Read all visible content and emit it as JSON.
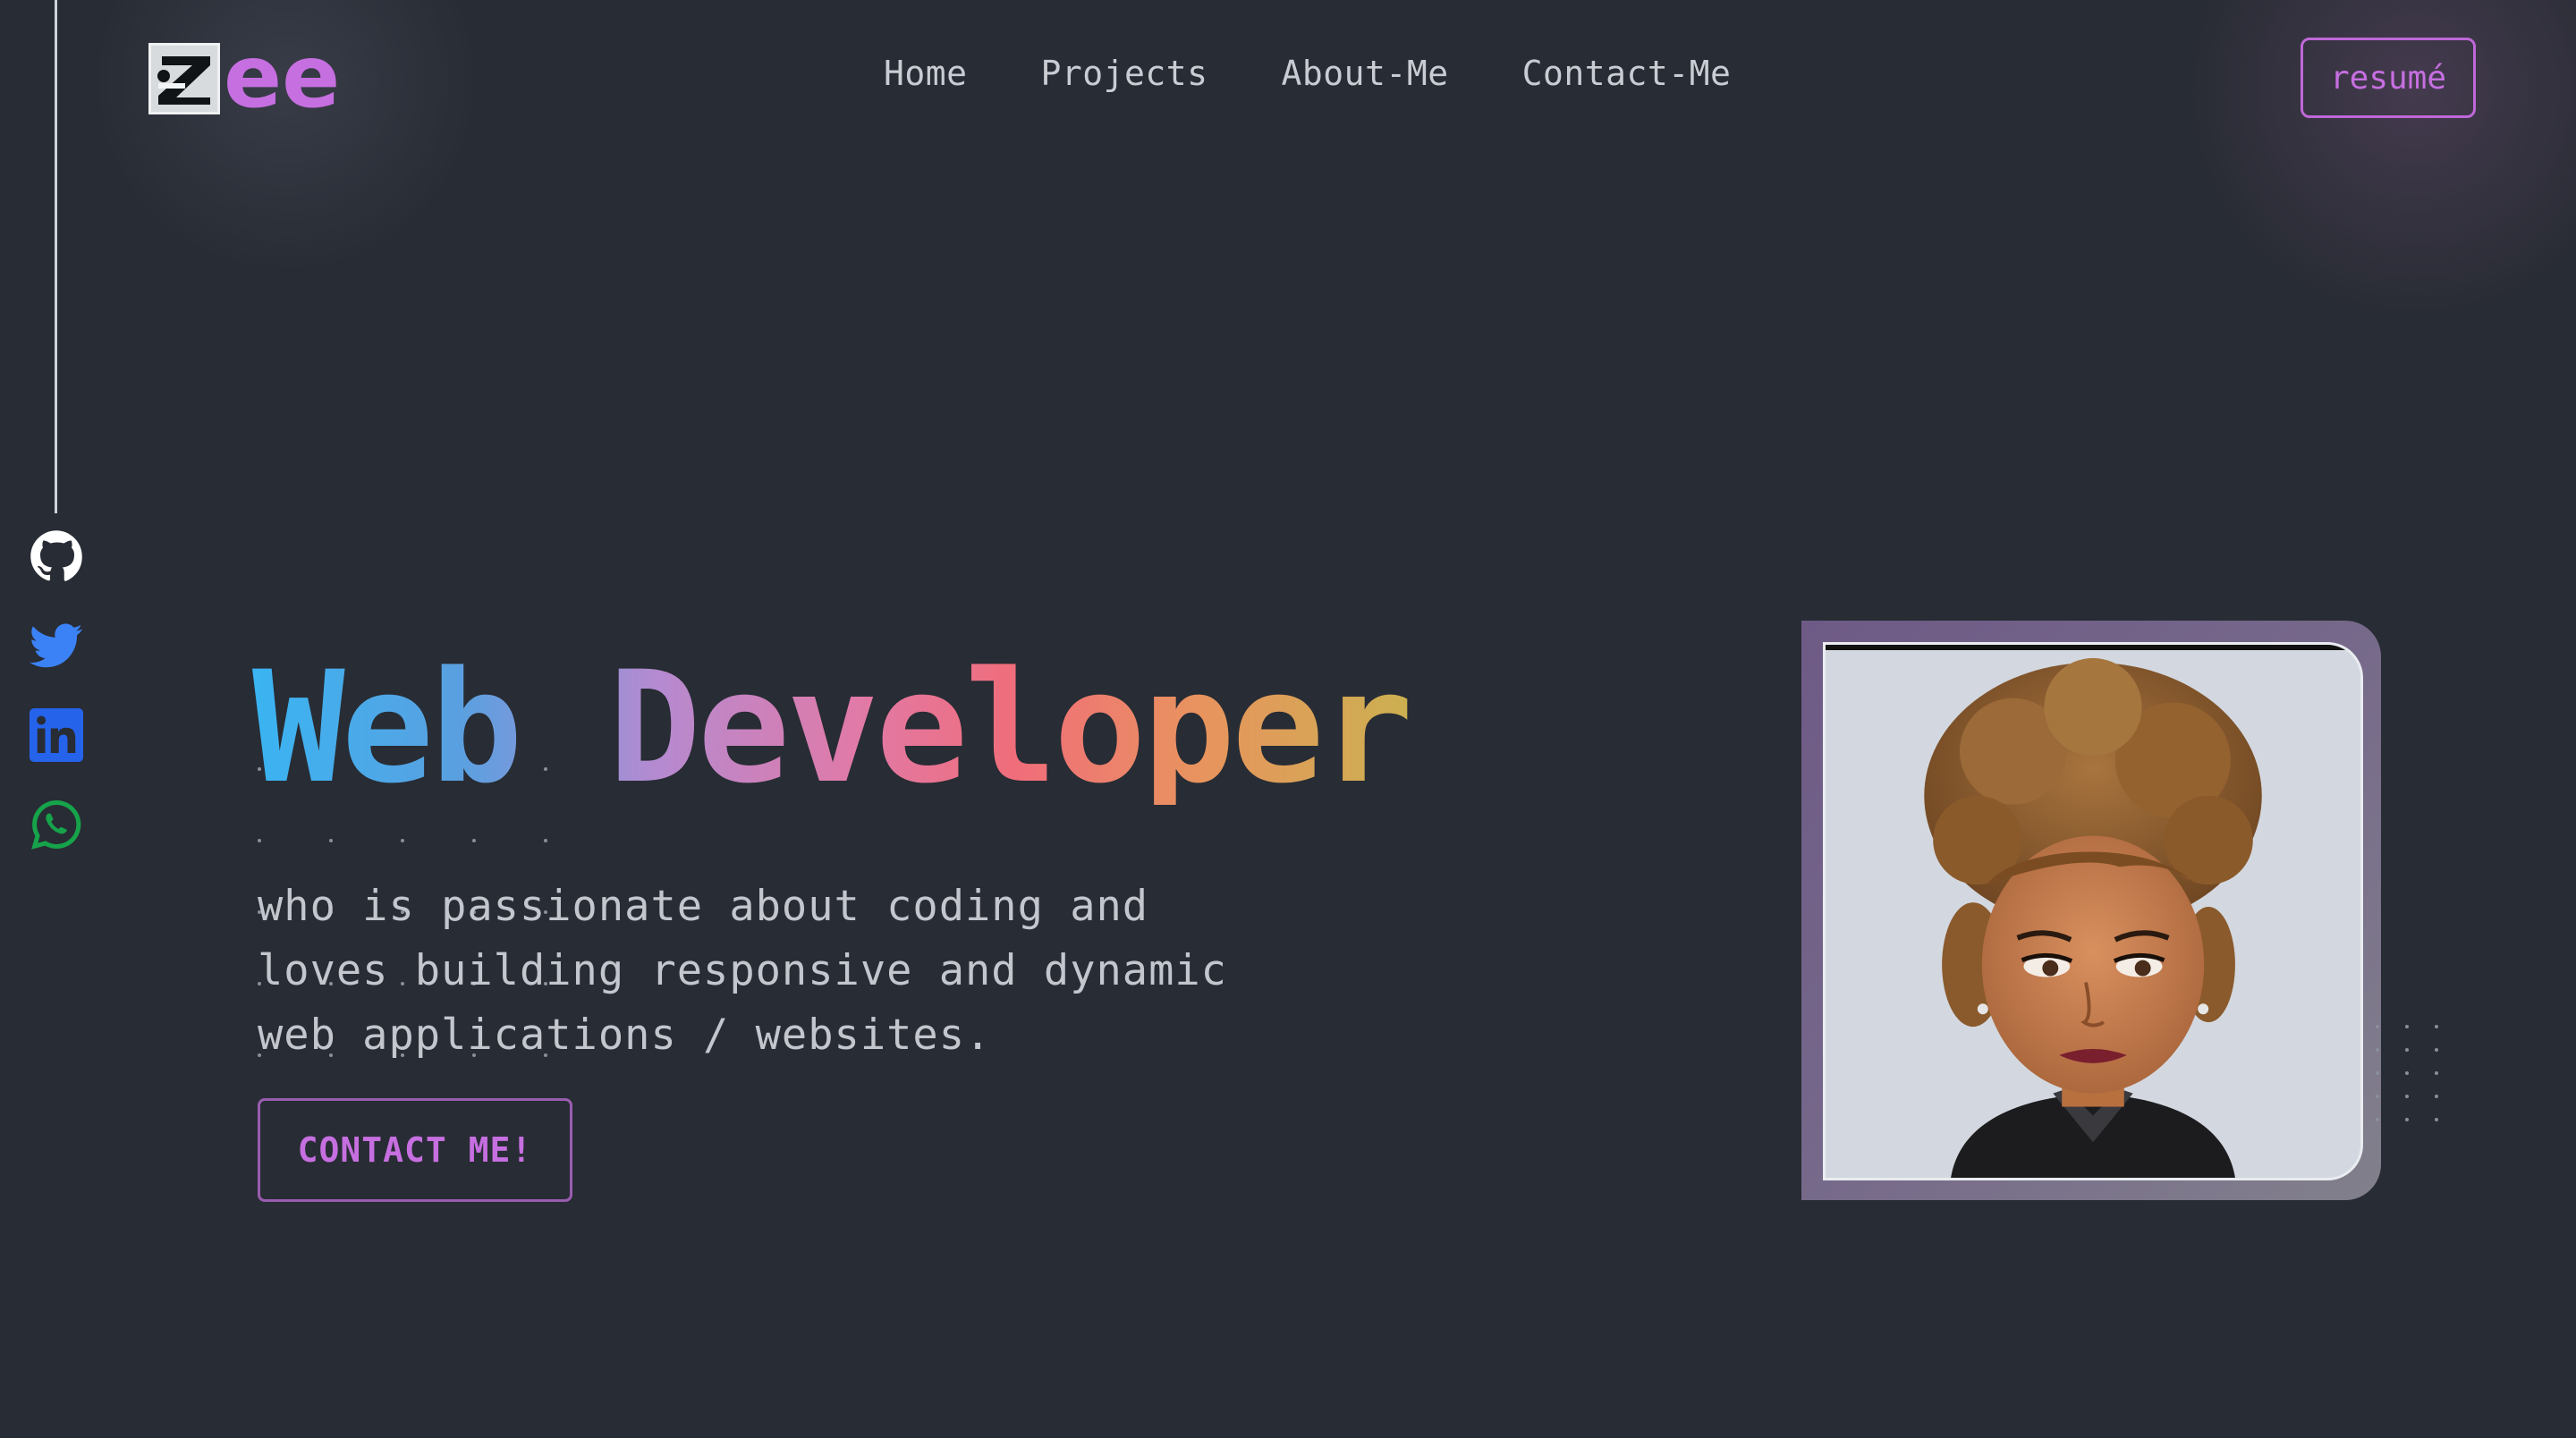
{
  "header": {
    "logo_text": "ee",
    "nav": [
      "Home",
      "Projects",
      "About-Me",
      "Contact-Me"
    ],
    "resume_label": "resumé"
  },
  "social": [
    "github-icon",
    "twitter-icon",
    "linkedin-icon",
    "whatsapp-icon"
  ],
  "hero": {
    "title": "Web Developer",
    "subtitle": "who is passionate about coding and loves building responsive and dynamic web applications / websites.",
    "cta_label": "CONTACT ME!"
  },
  "colors": {
    "background": "#282c34",
    "accent": "#c66fe0",
    "github": "#ffffff",
    "twitter": "#3b82f6",
    "linkedin": "#2563eb",
    "whatsapp": "#16a34a"
  }
}
